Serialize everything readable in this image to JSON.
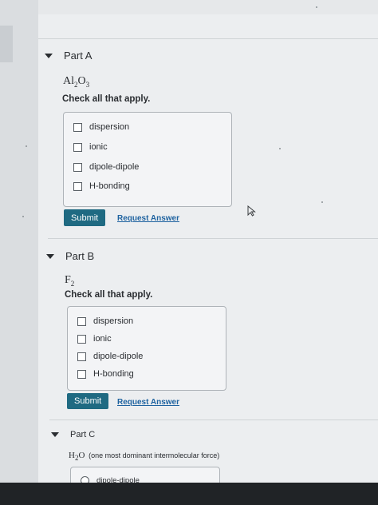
{
  "partA": {
    "title": "Part A",
    "formula": {
      "symbol1": "Al",
      "sub1": "2",
      "symbol2": "O",
      "sub2": "3"
    },
    "prompt": "Check all that apply.",
    "options": [
      "dispersion",
      "ionic",
      "dipole-dipole",
      "H-bonding"
    ],
    "submit": "Submit",
    "request": "Request Answer"
  },
  "partB": {
    "title": "Part B",
    "formula": {
      "symbol": "F",
      "sub": "2"
    },
    "prompt": "Check all that apply.",
    "options": [
      "dispersion",
      "ionic",
      "dipole-dipole",
      "H-bonding"
    ],
    "submit": "Submit",
    "request": "Request Answer"
  },
  "partC": {
    "title": "Part C",
    "formula": {
      "symbol1": "H",
      "sub": "2",
      "symbol2": "O"
    },
    "note": "(one most dominant intermolecular force)",
    "options": [
      "dipole-dipole"
    ]
  }
}
